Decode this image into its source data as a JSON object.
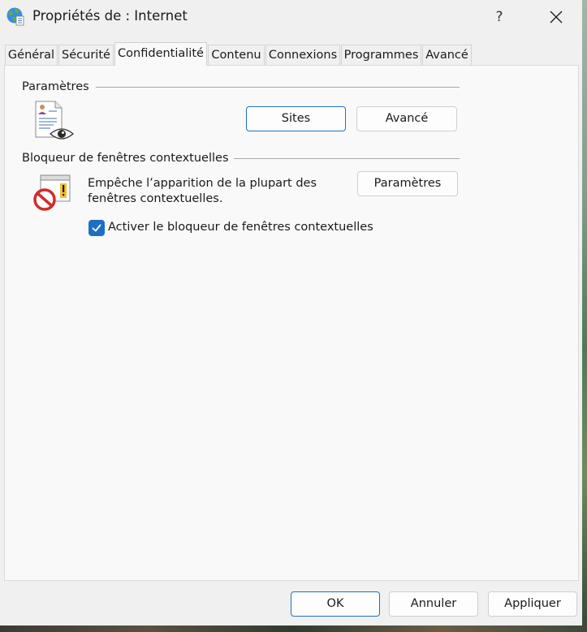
{
  "window": {
    "title": "Propriétés de : Internet",
    "help_label": "?",
    "icons": {
      "app": "internet-globe-icon",
      "close": "close-icon"
    }
  },
  "tabs": [
    {
      "label": "Général",
      "active": false
    },
    {
      "label": "Sécurité",
      "active": false
    },
    {
      "label": "Confidentialité",
      "active": true
    },
    {
      "label": "Contenu",
      "active": false
    },
    {
      "label": "Connexions",
      "active": false
    },
    {
      "label": "Programmes",
      "active": false
    },
    {
      "label": "Avancé",
      "active": false
    }
  ],
  "settings_group": {
    "label": "Paramètres",
    "icon": "privacy-document-eye-icon",
    "sites_button": "Sites",
    "advanced_button": "Avancé"
  },
  "popup_group": {
    "label": "Bloqueur de fenêtres contextuelles",
    "icon": "popup-blocker-icon",
    "description_line1": "Empêche l’apparition de la plupart des",
    "description_line2": "fenêtres contextuelles.",
    "settings_button": "Paramètres",
    "checkbox_label": "Activer le bloqueur de fenêtres contextuelles",
    "checkbox_checked": true
  },
  "footer": {
    "ok": "OK",
    "cancel": "Annuler",
    "apply": "Appliquer"
  },
  "colors": {
    "accent": "#1d6fc4",
    "panel_bg": "#f9f9f9",
    "window_bg": "#f0f0f0"
  }
}
